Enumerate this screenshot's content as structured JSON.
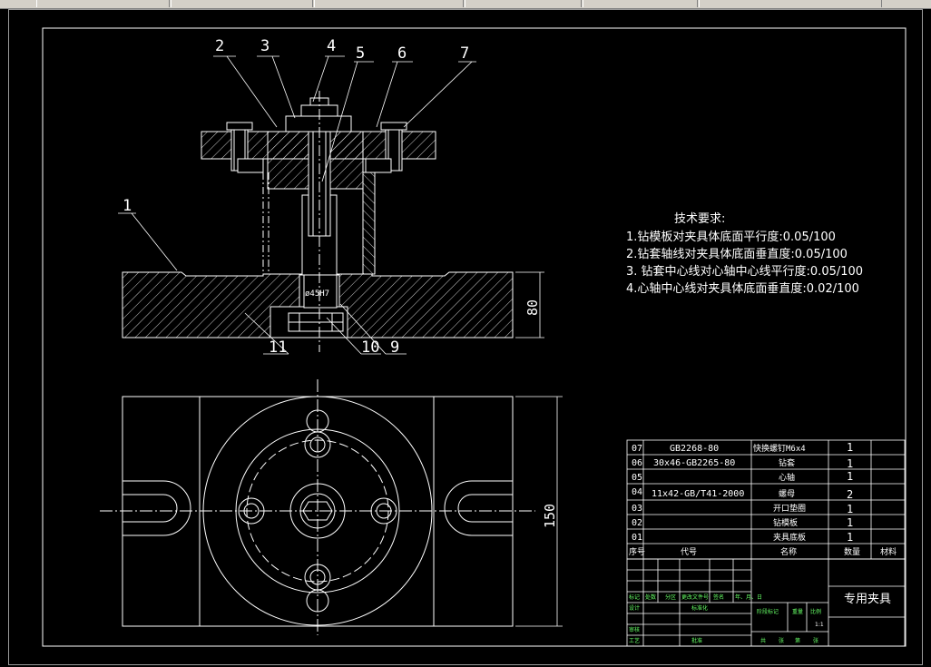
{
  "taskbar": {
    "buttons": [
      "",
      "",
      "",
      "",
      "",
      ""
    ]
  },
  "balloons": [
    "1",
    "2",
    "3",
    "4",
    "5",
    "6",
    "7",
    "9",
    "10",
    "11"
  ],
  "dimensions": {
    "height_side": "80",
    "height_top": "150",
    "fit": "ø45H7"
  },
  "tech_requirements": {
    "title": "技术要求:",
    "items": [
      "1.钻模板对夹具体底面平行度:0.05/100",
      "2.钻套轴线对夹具体底面垂直度:0.05/100",
      "3. 钻套中心线对心轴中心线平行度:0.05/100",
      "4.心轴中心线对夹具体底面垂直度:0.02/100"
    ]
  },
  "bom": {
    "headers": {
      "no": "序号",
      "code": "代号",
      "name": "名称",
      "qty": "数量",
      "material": "材料"
    },
    "rows": [
      {
        "no": "07",
        "code": "GB2268-80",
        "name": "快换螺钉M6x4",
        "qty": "1"
      },
      {
        "no": "06",
        "code": "30x46-GB2265-80",
        "name": "钻套",
        "qty": "1"
      },
      {
        "no": "05",
        "code": "",
        "name": "心轴",
        "qty": "1"
      },
      {
        "no": "04",
        "code": "11x42-GB/T41-2000",
        "name": "螺母",
        "qty": "2"
      },
      {
        "no": "03",
        "code": "",
        "name": "开口垫圈",
        "qty": "1"
      },
      {
        "no": "02",
        "code": "",
        "name": "钻模板",
        "qty": "1"
      },
      {
        "no": "01",
        "code": "",
        "name": "夹具底板",
        "qty": "1"
      }
    ]
  },
  "title_block": {
    "drawing_name": "专用夹具",
    "scale": "1:1",
    "row_labels": [
      "标记",
      "处数",
      "分区",
      "更改文件号",
      "签名",
      "年、月、日"
    ],
    "design": "设计",
    "review": "审核",
    "process": "工艺",
    "standard": "标准化",
    "approve": "批准",
    "stage": "阶段标记",
    "weight": "重量",
    "ratio": "比例",
    "sheets": [
      "共",
      "张",
      "第",
      "张"
    ]
  }
}
